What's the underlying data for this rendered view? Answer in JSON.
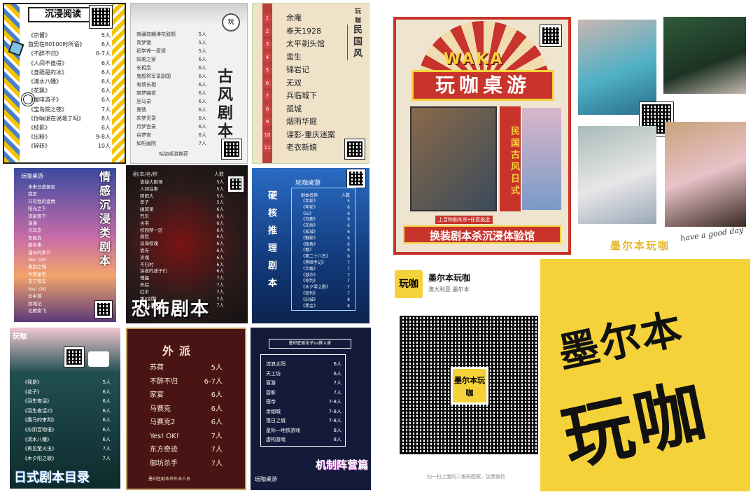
{
  "p1": {
    "title": "沉浸阅读",
    "items": [
      {
        "name": "《京酱》",
        "count": "5人"
      },
      {
        "name": "首男在80100时所语》",
        "count": "6人"
      },
      {
        "name": "《不醉不归》",
        "count": "6-7人"
      },
      {
        "name": "《人间不值得》",
        "count": "6人"
      },
      {
        "name": "《身跟是的冰》",
        "count": "6人"
      },
      {
        "name": "《清水八幡》",
        "count": "6人"
      },
      {
        "name": "《花飘》",
        "count": "6人"
      },
      {
        "name": "《咖啡游子》",
        "count": "6人"
      },
      {
        "name": "《宝岛院之夜》",
        "count": "7人"
      },
      {
        "name": "《你呐退在说哦了吗》",
        "count": "8人"
      },
      {
        "name": "《枝影》",
        "count": "6人"
      },
      {
        "name": "《出粉》",
        "count": "9-8人"
      },
      {
        "name": "《碎砖》",
        "count": "10人"
      }
    ]
  },
  "p2": {
    "title": "古风剧本",
    "footer": "咕咖桌游推荐",
    "items": [
      {
        "name": "南疆故翩涛花鼓题",
        "count": "5人"
      },
      {
        "name": "青梦馆",
        "count": "5人"
      },
      {
        "name": "初学养一原情",
        "count": "5人"
      },
      {
        "name": "知难之家",
        "count": "6人"
      },
      {
        "name": "长相念",
        "count": "6人"
      },
      {
        "name": "鬼般将军录副国",
        "count": "6人"
      },
      {
        "name": "有情长相",
        "count": "6人"
      },
      {
        "name": "南梦幽花",
        "count": "6人"
      },
      {
        "name": "巫马录",
        "count": "6人"
      },
      {
        "name": "熹情",
        "count": "6人"
      },
      {
        "name": "朱梦灵录",
        "count": "6人"
      },
      {
        "name": "月梦宫录",
        "count": "6人"
      },
      {
        "name": "谷梦宫",
        "count": "6人"
      },
      {
        "name": "如阳画院",
        "count": "7人"
      }
    ]
  },
  "p3": {
    "title": "民国风",
    "brand": "玩咖",
    "items": [
      {
        "num": "1",
        "name": "余庵"
      },
      {
        "num": "2",
        "name": "奉天1928"
      },
      {
        "num": "3",
        "name": "太平剃头馆"
      },
      {
        "num": "4",
        "name": "蛮生"
      },
      {
        "num": "5",
        "name": "锦岩记"
      },
      {
        "num": "6",
        "name": "无双"
      },
      {
        "num": "7",
        "name": "兵临城下"
      },
      {
        "num": "8",
        "name": "孤城"
      },
      {
        "num": "9",
        "name": "烟雨华庭"
      },
      {
        "num": "10",
        "name": "谍影-重庆迷案"
      },
      {
        "num": "11",
        "name": "老衣新娘"
      }
    ]
  },
  "p4": {
    "title": "情感沉浸类剧本",
    "brand": "玩咖桌游",
    "items": [
      "未来日遗报恩",
      "我是",
      "只有我的爱情",
      "阳光之下",
      "流星雨下",
      "深海",
      "光年恋",
      "东极岛",
      "那件事",
      "漫长的季节",
      "Yes! OK!",
      "离别之城",
      "今夜星空",
      "东方快车",
      "Yes! OK!",
      "云中游",
      "双城记",
      "北雁南飞"
    ]
  },
  "p5": {
    "title": "恐怖剧本",
    "header": "剧/本/名/称",
    "header_count": "人数",
    "items": [
      {
        "name": "诡秘大剧场",
        "count": "5人"
      },
      {
        "name": "人间往事",
        "count": "5人"
      },
      {
        "name": "阴阳大",
        "count": "5人"
      },
      {
        "name": "孝子",
        "count": "5人"
      },
      {
        "name": "幽冥录",
        "count": "6人"
      },
      {
        "name": "咒乐",
        "count": "6人"
      },
      {
        "name": "古宅",
        "count": "6人"
      },
      {
        "name": "校园禁一区",
        "count": "6人"
      },
      {
        "name": "病院",
        "count": "6人"
      },
      {
        "name": "深海惊魂",
        "count": "6人"
      },
      {
        "name": "诡寺",
        "count": "6人"
      },
      {
        "name": "灵魂",
        "count": "6人"
      },
      {
        "name": "不归村",
        "count": "6人"
      },
      {
        "name": "深夜的孩子们",
        "count": "6人"
      },
      {
        "name": "傀儡",
        "count": "7人"
      },
      {
        "name": "失踪",
        "count": "7人"
      },
      {
        "name": "红伞",
        "count": "7人"
      },
      {
        "name": "第2别墅",
        "count": "7人"
      },
      {
        "name": "阴阳山",
        "count": "7人"
      }
    ]
  },
  "p6": {
    "title": "硬核推理剧本",
    "brand": "玩咖桌游",
    "header_name": "剧本名称",
    "header_count": "人数",
    "items": [
      {
        "name": "《年轮》",
        "count": "5"
      },
      {
        "name": "《年轮》",
        "count": "6"
      },
      {
        "name": "《山》",
        "count": "6"
      },
      {
        "name": "《白鹿》",
        "count": "6"
      },
      {
        "name": "《灰烬》",
        "count": "6"
      },
      {
        "name": "《孤城》",
        "count": "6"
      },
      {
        "name": "《魅影》",
        "count": "6"
      },
      {
        "name": "《隐角》",
        "count": "6"
      },
      {
        "name": "《春》",
        "count": "6"
      },
      {
        "name": "《第二十八名》",
        "count": "6"
      },
      {
        "name": "《黑暗手记》",
        "count": "7"
      },
      {
        "name": "《半截》",
        "count": "7"
      },
      {
        "name": "《潮汐》",
        "count": "7"
      },
      {
        "name": "《审判》",
        "count": "7"
      },
      {
        "name": "《木夕零之歌》",
        "count": "7"
      },
      {
        "name": "《审判》",
        "count": "7"
      },
      {
        "name": "《旧城》",
        "count": "8"
      },
      {
        "name": "《黑金》",
        "count": "8"
      }
    ]
  },
  "p7": {
    "title": "日式剧本目录",
    "brand": "玩咖",
    "items": [
      {
        "name": "《我是》",
        "count": "5人"
      },
      {
        "name": "《花子》",
        "count": "6人"
      },
      {
        "name": "《羽生夜话》",
        "count": "6人"
      },
      {
        "name": "《羽生夜话2》",
        "count": "6人"
      },
      {
        "name": "《鹰马的审判》",
        "count": "6人"
      },
      {
        "name": "《忘阴百物语》",
        "count": "6人"
      },
      {
        "name": "《清水八幡》",
        "count": "6人"
      },
      {
        "name": "《再见萤火虫》",
        "count": "7人"
      },
      {
        "name": "《木夕阳之歌》",
        "count": "7人"
      }
    ]
  },
  "p8": {
    "title": "外派",
    "footer": "墨印匠剧本杀外派人员",
    "items": [
      {
        "name": "苏荷",
        "count": "5人"
      },
      {
        "name": "不醉不归",
        "count": "6-7人"
      },
      {
        "name": "家宴",
        "count": "6人"
      },
      {
        "name": "马赛克",
        "count": "6人"
      },
      {
        "name": "马赛克2",
        "count": "6人"
      },
      {
        "name": "Yes! OK!",
        "count": "7人"
      },
      {
        "name": "东方奇迹",
        "count": "7人"
      },
      {
        "name": "御坊杀手",
        "count": "7人"
      }
    ]
  },
  "p9": {
    "title": "机制阵营篇",
    "header": "墨印匠剧本杀vs推入家",
    "brand": "玩咖桌游",
    "tag": "玩咖桌游",
    "items": [
      {
        "name": "流浪太阳",
        "count": "6人"
      },
      {
        "name": "天工坊",
        "count": "6人"
      },
      {
        "name": "窗游",
        "count": "7人"
      },
      {
        "name": "碧影",
        "count": "7人"
      },
      {
        "name": "宿帝",
        "count": "7-8人"
      },
      {
        "name": "余烟城",
        "count": "7-8人"
      },
      {
        "name": "落日之城",
        "count": "7-8人"
      },
      {
        "name": "星际一地铁游戏",
        "count": "8人"
      },
      {
        "name": "虚构游戏",
        "count": "8人"
      }
    ]
  },
  "poster": {
    "brand": "WAKA",
    "title": "玩咖桌游",
    "vertical": "民国古风日式",
    "small_vertical": "日式 古风 民国",
    "banner": "换装剧本杀沉浸体验馆",
    "ribbon": "上百种剧本杀•任君挑选"
  },
  "photos": {
    "caption": "墨尔本玩咖",
    "handwriting": "have a good day"
  },
  "qrcard": {
    "logo_text": "玩咖",
    "name": "墨尔本玩咖",
    "location": "澳大利亚 墨尔本",
    "center_logo": "墨尔本玩咖",
    "footer": "扫一扫上面的二维码图案，加我微信"
  },
  "yellow": {
    "line1": "墨尔本",
    "line2": "玩咖"
  },
  "colors": {
    "yellow": "#f5d23a",
    "poster_red": "#c8342c",
    "poster_bg": "#efe4cf",
    "dark_navy": "#141a3a",
    "horror_dark": "#1d1b1b",
    "blue": "#1f5fa8"
  }
}
